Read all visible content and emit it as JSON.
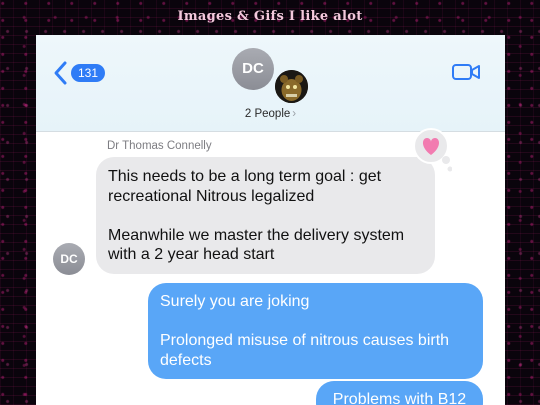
{
  "site_title": "Images & Gifs I like alot",
  "header": {
    "back_count": "131",
    "avatar_initials": "DC",
    "group_label": "2 People",
    "group_chevron": "›"
  },
  "thread": {
    "sender_name": "Dr Thomas Connelly",
    "sender_initials": "DC",
    "tapback_icon": "heart-icon",
    "messages": [
      {
        "direction": "incoming",
        "text": "This needs to be a long term goal : get recreational Nitrous legalized\n\nMeanwhile we master the delivery system with a 2 year head start"
      },
      {
        "direction": "outgoing",
        "text": "Surely you are joking\n\nProlonged misuse of nitrous causes birth defects"
      },
      {
        "direction": "outgoing",
        "text": "Problems with B12"
      }
    ]
  },
  "colors": {
    "accent": "#2f7cf6",
    "outgoing_bubble": "#59a6f7",
    "incoming_bubble": "#e9e9eb",
    "tapback_heart": "#f27bb0"
  }
}
